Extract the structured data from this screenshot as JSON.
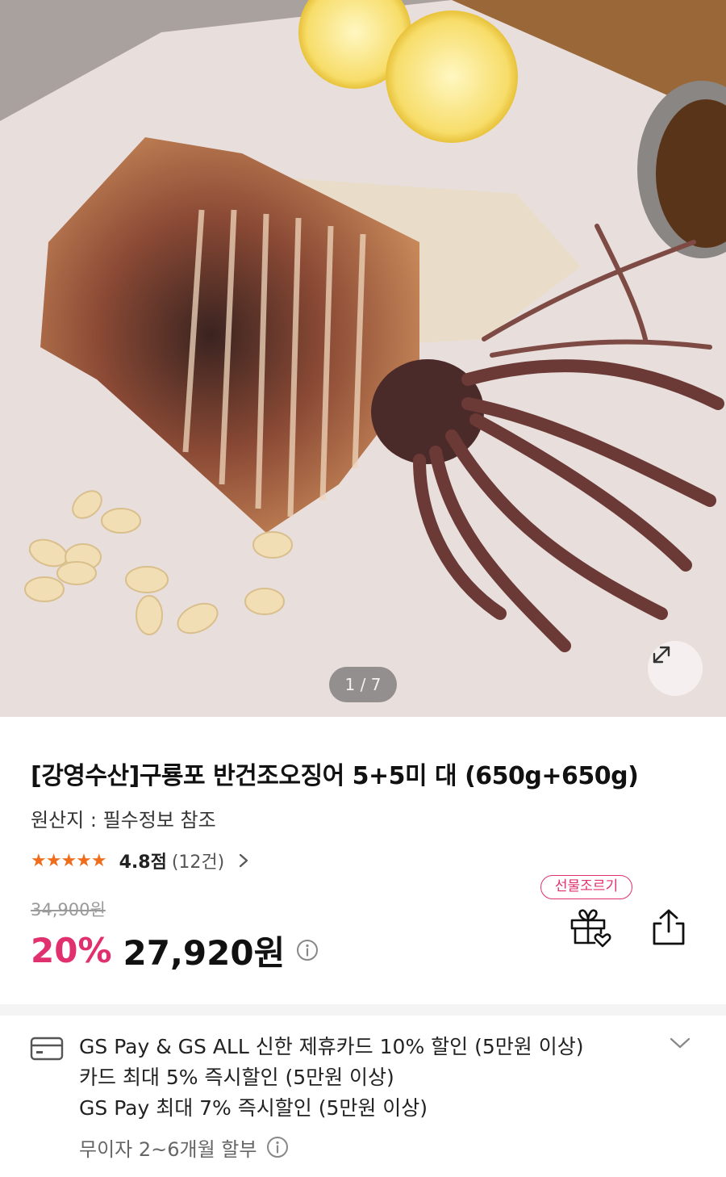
{
  "gallery": {
    "current": 1,
    "total": 7,
    "counter_text": "1 / 7",
    "expand_icon": "expand-icon"
  },
  "product": {
    "title": "[강영수산]구룡포 반건조오징어 5+5미 대 (650g+650g)",
    "origin": "원산지 : 필수정보 참조",
    "rating": {
      "stars": "★★★★★",
      "star_value": 4.8,
      "score": "4.8점",
      "count": "(12건)"
    },
    "original_price": "34,900원",
    "discount_rate": "20%",
    "sale_price": "27,920원"
  },
  "actions": {
    "gift_label": "선물조르기",
    "gift_icon": "gift-heart-icon",
    "share_icon": "share-icon"
  },
  "benefits": {
    "card_icon": "credit-card-icon",
    "lines": [
      "GS Pay & GS ALL 신한 제휴카드 10% 할인 (5만원 이상)",
      "카드 최대 5% 즉시할인 (5만원 이상)",
      "GS Pay 최대 7% 즉시할인 (5만원 이상)"
    ],
    "installment": "무이자 2~6개월 할부"
  },
  "colors": {
    "accent": "#e0306e",
    "star": "#f06d1d",
    "muted": "#9a9a9a"
  }
}
